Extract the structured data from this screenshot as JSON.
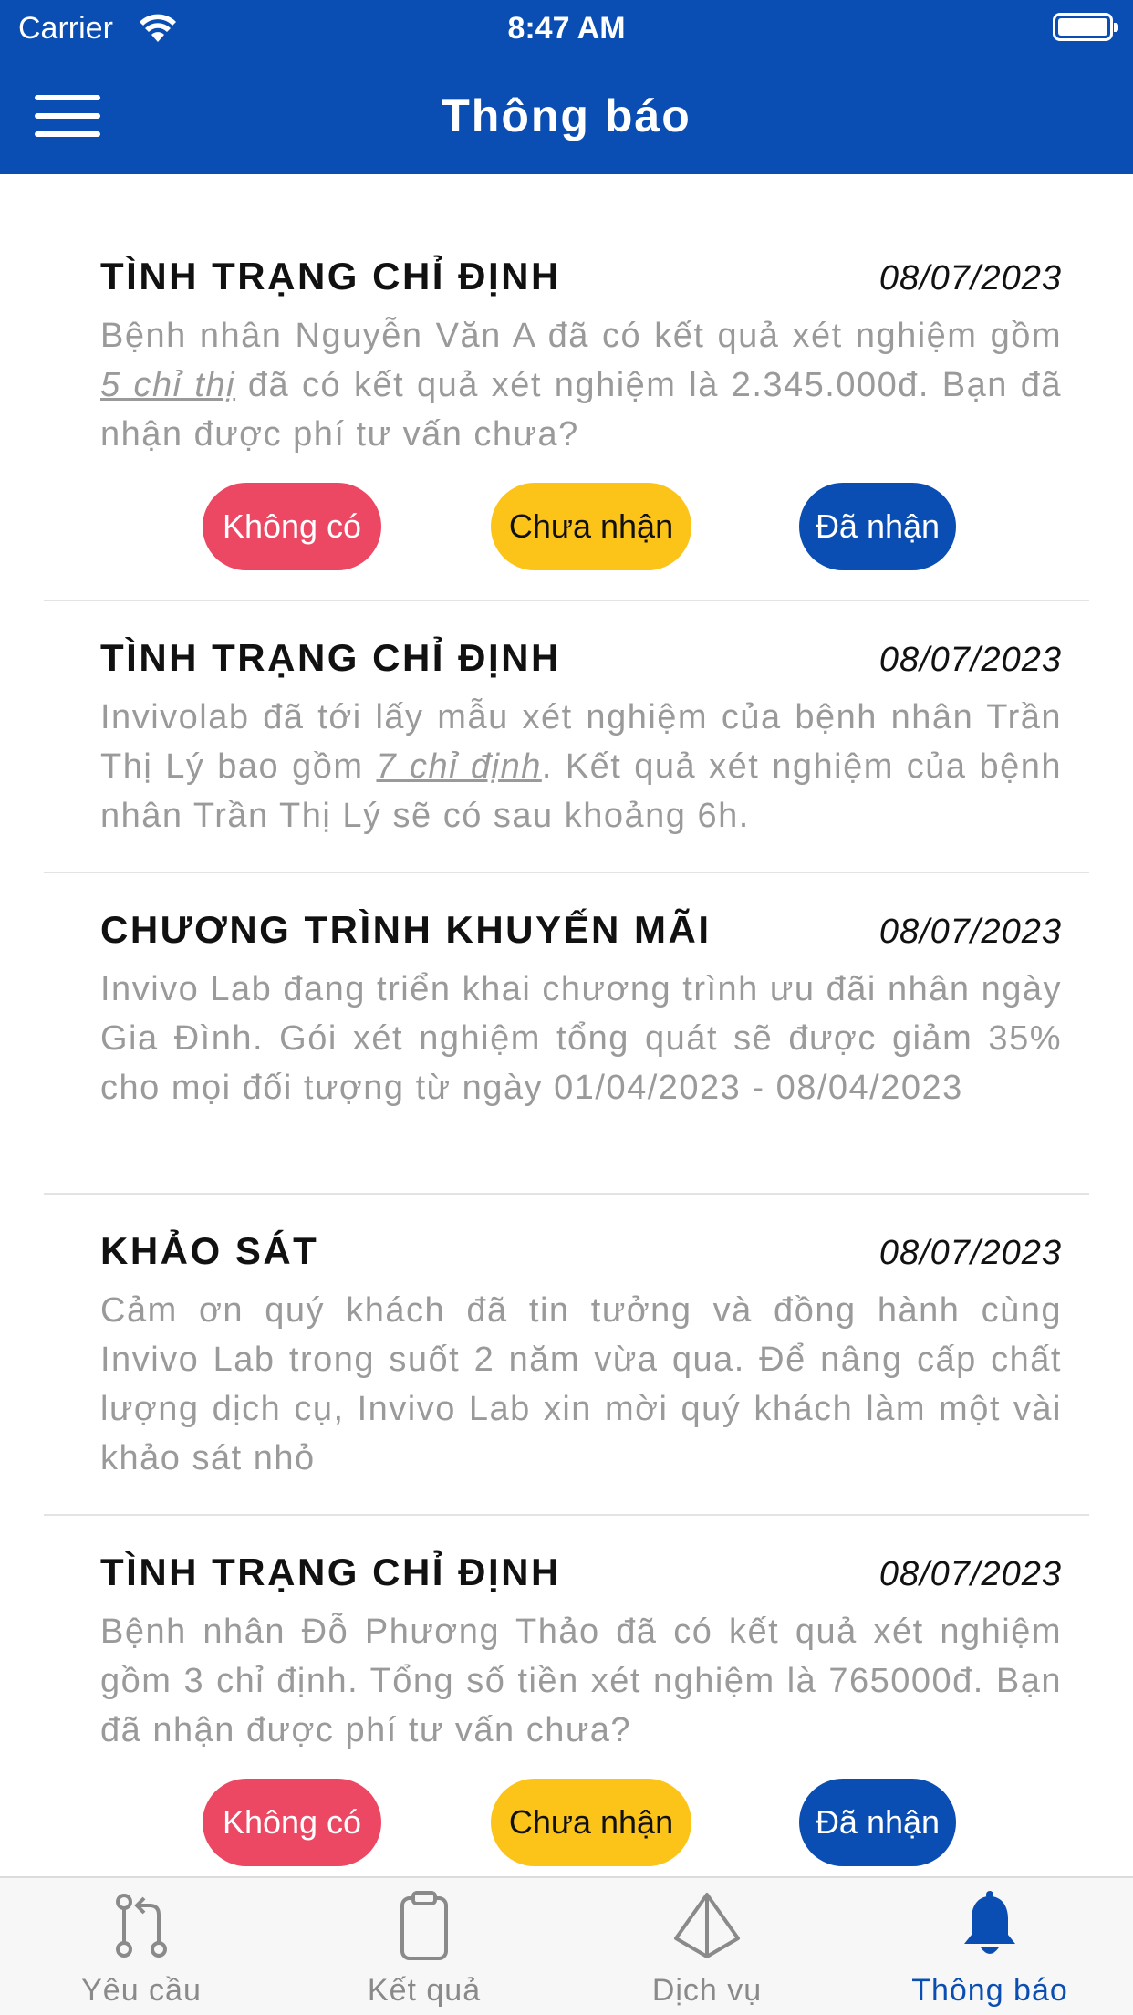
{
  "status_bar": {
    "carrier": "Carrier",
    "time": "8:47 AM"
  },
  "header": {
    "title": "Thông báo"
  },
  "notifications": [
    {
      "title": "TÌNH TRẠNG CHỈ ĐỊNH",
      "date": "08/07/2023",
      "text_before": "Bệnh nhân Nguyễn Văn A đã có kết quả xét nghiệm gồm ",
      "link": "5 chỉ thị",
      "text_after": " đã có kết quả xét nghiệm là 2.345.000đ. Bạn đã nhận được phí tư vấn chưa?",
      "actions": {
        "no": "Không có",
        "pending": "Chưa nhận",
        "received": "Đã nhận"
      }
    },
    {
      "title": "TÌNH TRẠNG CHỈ ĐỊNH",
      "date": "08/07/2023",
      "text_before": "Invivolab đã tới lấy mẫu xét nghiệm của bệnh nhân Trần Thị Lý bao gồm ",
      "link": "7 chỉ định",
      "text_after": ". Kết quả xét nghiệm của bệnh nhân Trần Thị Lý sẽ có sau khoảng 6h."
    },
    {
      "title": "CHƯƠNG TRÌNH KHUYẾN MÃI",
      "date": "08/07/2023",
      "text": "Invivo Lab đang triển khai chương trình ưu đãi nhân ngày Gia Đình. Gói xét nghiệm tổng quát sẽ được giảm 35% cho mọi đối tượng từ ngày 01/04/2023 - 08/04/2023"
    },
    {
      "title": "KHẢO SÁT",
      "date": "08/07/2023",
      "text": "Cảm ơn quý khách đã tin tưởng và đồng hành cùng Invivo Lab trong suốt 2 năm vừa qua. Để nâng cấp chất lượng dịch cụ, Invivo Lab xin mời quý khách làm một vài khảo sát nhỏ"
    },
    {
      "title": "TÌNH TRẠNG CHỈ ĐỊNH",
      "date": "08/07/2023",
      "text": "Bệnh nhân Đỗ Phương Thảo đã có kết quả xét nghiệm gồm 3 chỉ định. Tổng số tiền xét nghiệm là 765000đ. Bạn đã nhận được phí tư vấn chưa?",
      "actions": {
        "no": "Không có",
        "pending": "Chưa nhận",
        "received": "Đã nhận"
      }
    }
  ],
  "tabbar": {
    "tabs": [
      {
        "label": "Yêu cầu",
        "icon": "pull-request-icon"
      },
      {
        "label": "Kết quả",
        "icon": "clipboard-icon"
      },
      {
        "label": "Dịch vụ",
        "icon": "prism-icon"
      },
      {
        "label": "Thông báo",
        "icon": "bell-icon",
        "active": true
      }
    ]
  },
  "colors": {
    "primary": "#0a4eb3",
    "danger": "#ec4863",
    "warning": "#fcc419",
    "muted_text": "#9a9a9a"
  }
}
